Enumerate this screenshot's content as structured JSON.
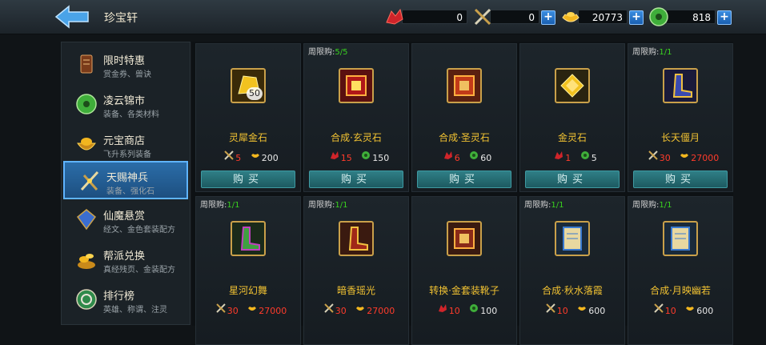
{
  "header": {
    "title": "珍宝轩"
  },
  "resources": [
    {
      "icon": "red-shard-icon",
      "value": "0",
      "has_plus": false
    },
    {
      "icon": "crossed-swords-icon",
      "value": "0",
      "has_plus": true
    },
    {
      "icon": "gold-ingot-icon",
      "value": "20773",
      "has_plus": true
    },
    {
      "icon": "jade-coin-icon",
      "value": "818",
      "has_plus": true
    }
  ],
  "sidebar": {
    "items": [
      {
        "name": "限时特惠",
        "sub": "赏金券、兽诀",
        "icon": "scroll-icon",
        "active": false
      },
      {
        "name": "凌云锦市",
        "sub": "装备、各类材料",
        "icon": "jade-coin-icon",
        "active": false
      },
      {
        "name": "元宝商店",
        "sub": "飞升系列装备",
        "icon": "treasure-bowl-icon",
        "active": false
      },
      {
        "name": "天赐神兵",
        "sub": "装备、强化石",
        "icon": "weapons-icon",
        "active": true
      },
      {
        "name": "仙魔悬赏",
        "sub": "经文、金色套装配方",
        "icon": "crystal-icon",
        "active": false
      },
      {
        "name": "帮派兑换",
        "sub": "真经残页、金装配方",
        "icon": "gold-pile-icon",
        "active": false
      },
      {
        "name": "排行榜",
        "sub": "英雄、称谓、注灵",
        "icon": "medal-icon",
        "active": false
      }
    ]
  },
  "limit_prefix": "周限购:",
  "buy_label": "购买",
  "items": [
    {
      "name": "灵犀金石",
      "limit": "",
      "limit_count": "",
      "qty": "50",
      "icon": "gold-stone-icon",
      "cost1_icon": "crossed-swords-icon",
      "cost1": "5",
      "cost2_icon": "gold-ingot-icon",
      "cost2": "200",
      "cost2_red": false
    },
    {
      "name": "合成·玄灵石",
      "limit": "周限购:",
      "limit_count": "5/5",
      "qty": "",
      "icon": "red-scroll-icon",
      "cost1_icon": "red-shard-icon",
      "cost1": "15",
      "cost2_icon": "jade-coin-icon",
      "cost2": "150",
      "cost2_red": false
    },
    {
      "name": "合成·圣灵石",
      "limit": "",
      "limit_count": "",
      "qty": "",
      "icon": "red-scroll-icon",
      "cost1_icon": "red-shard-icon",
      "cost1": "6",
      "cost2_icon": "jade-coin-icon",
      "cost2": "60",
      "cost2_red": false
    },
    {
      "name": "金灵石",
      "limit": "",
      "limit_count": "",
      "qty": "",
      "icon": "gold-crystal-icon",
      "cost1_icon": "red-shard-icon",
      "cost1": "1",
      "cost2_icon": "jade-coin-icon",
      "cost2": "5",
      "cost2_red": false
    },
    {
      "name": "长天僵月",
      "limit": "周限购:",
      "limit_count": "1/1",
      "qty": "",
      "icon": "boots-icon",
      "cost1_icon": "crossed-swords-icon",
      "cost1": "30",
      "cost2_icon": "gold-ingot-icon",
      "cost2": "27000",
      "cost2_red": true
    },
    {
      "name": "星河幻舞",
      "limit": "周限购:",
      "limit_count": "1/1",
      "qty": "",
      "icon": "green-boots-icon",
      "cost1_icon": "crossed-swords-icon",
      "cost1": "30",
      "cost2_icon": "gold-ingot-icon",
      "cost2": "27000",
      "cost2_red": true
    },
    {
      "name": "暗香瑶光",
      "limit": "周限购:",
      "limit_count": "1/1",
      "qty": "",
      "icon": "red-boots-icon",
      "cost1_icon": "crossed-swords-icon",
      "cost1": "30",
      "cost2_icon": "gold-ingot-icon",
      "cost2": "27000",
      "cost2_red": true
    },
    {
      "name": "转换·金套装靴子",
      "limit": "",
      "limit_count": "",
      "qty": "",
      "icon": "red-scroll-icon",
      "cost1_icon": "red-shard-icon",
      "cost1": "10",
      "cost2_icon": "jade-coin-icon",
      "cost2": "100",
      "cost2_red": false
    },
    {
      "name": "合成·秋水落霞",
      "limit": "周限购:",
      "limit_count": "1/1",
      "qty": "",
      "icon": "blue-scroll-icon",
      "cost1_icon": "crossed-swords-icon",
      "cost1": "10",
      "cost2_icon": "gold-ingot-icon",
      "cost2": "600",
      "cost2_red": false
    },
    {
      "name": "合成·月映幽若",
      "limit": "周限购:",
      "limit_count": "1/1",
      "qty": "",
      "icon": "blue-scroll-icon",
      "cost1_icon": "crossed-swords-icon",
      "cost1": "10",
      "cost2_icon": "gold-ingot-icon",
      "cost2": "600",
      "cost2_red": false
    }
  ]
}
